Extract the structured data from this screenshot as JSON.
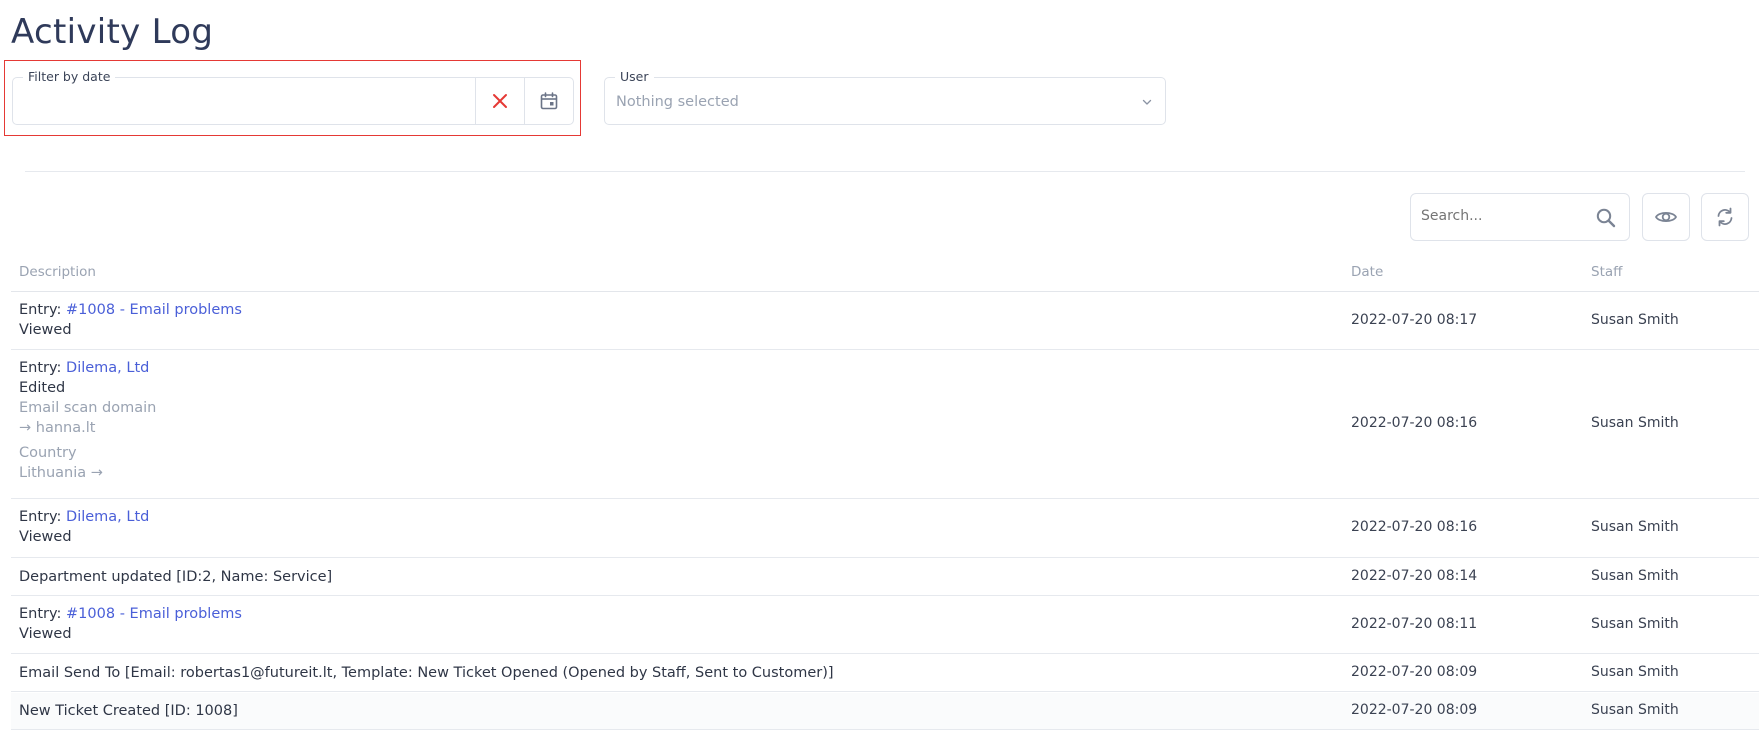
{
  "page": {
    "title": "Activity Log"
  },
  "filters": {
    "date": {
      "legend": "Filter by date",
      "value": ""
    },
    "user": {
      "legend": "User",
      "value": "Nothing selected"
    }
  },
  "toolbar": {
    "search_placeholder": "Search..."
  },
  "table": {
    "headers": {
      "description": "Description",
      "date": "Date",
      "staff": "Staff"
    },
    "rows": [
      {
        "prefix": "Entry: ",
        "link": "#1008 - Email problems",
        "action": "Viewed",
        "date": "2022-07-20 08:17",
        "staff": "Susan Smith"
      },
      {
        "prefix": "Entry: ",
        "link": "Dilema, Ltd",
        "action": "Edited",
        "change1_field": "Email scan domain",
        "change1_value": "→ hanna.lt",
        "change2_field": "Country",
        "change2_value": "Lithuania →",
        "date": "2022-07-20 08:16",
        "staff": "Susan Smith"
      },
      {
        "prefix": "Entry: ",
        "link": "Dilema, Ltd",
        "action": "Viewed",
        "date": "2022-07-20 08:16",
        "staff": "Susan Smith"
      },
      {
        "text": "Department updated [ID:2, Name: Service]",
        "date": "2022-07-20 08:14",
        "staff": "Susan Smith"
      },
      {
        "prefix": "Entry: ",
        "link": "#1008 - Email problems",
        "action": "Viewed",
        "date": "2022-07-20 08:11",
        "staff": "Susan Smith"
      },
      {
        "text": "Email Send To [Email: robertas1@futureit.lt, Template: New Ticket Opened (Opened by Staff, Sent to Customer)]",
        "date": "2022-07-20 08:09",
        "staff": "Susan Smith"
      },
      {
        "text": "New Ticket Created [ID: 1008]",
        "date": "2022-07-20 08:09",
        "staff": "Susan Smith"
      }
    ]
  },
  "colors": {
    "accent_link": "#4a5fd8",
    "clear_icon": "#e53935",
    "highlight_border": "#e53935"
  },
  "icons": [
    "close-icon",
    "calendar-icon",
    "chevron-down-icon",
    "search-icon",
    "eye-icon",
    "refresh-icon"
  ]
}
